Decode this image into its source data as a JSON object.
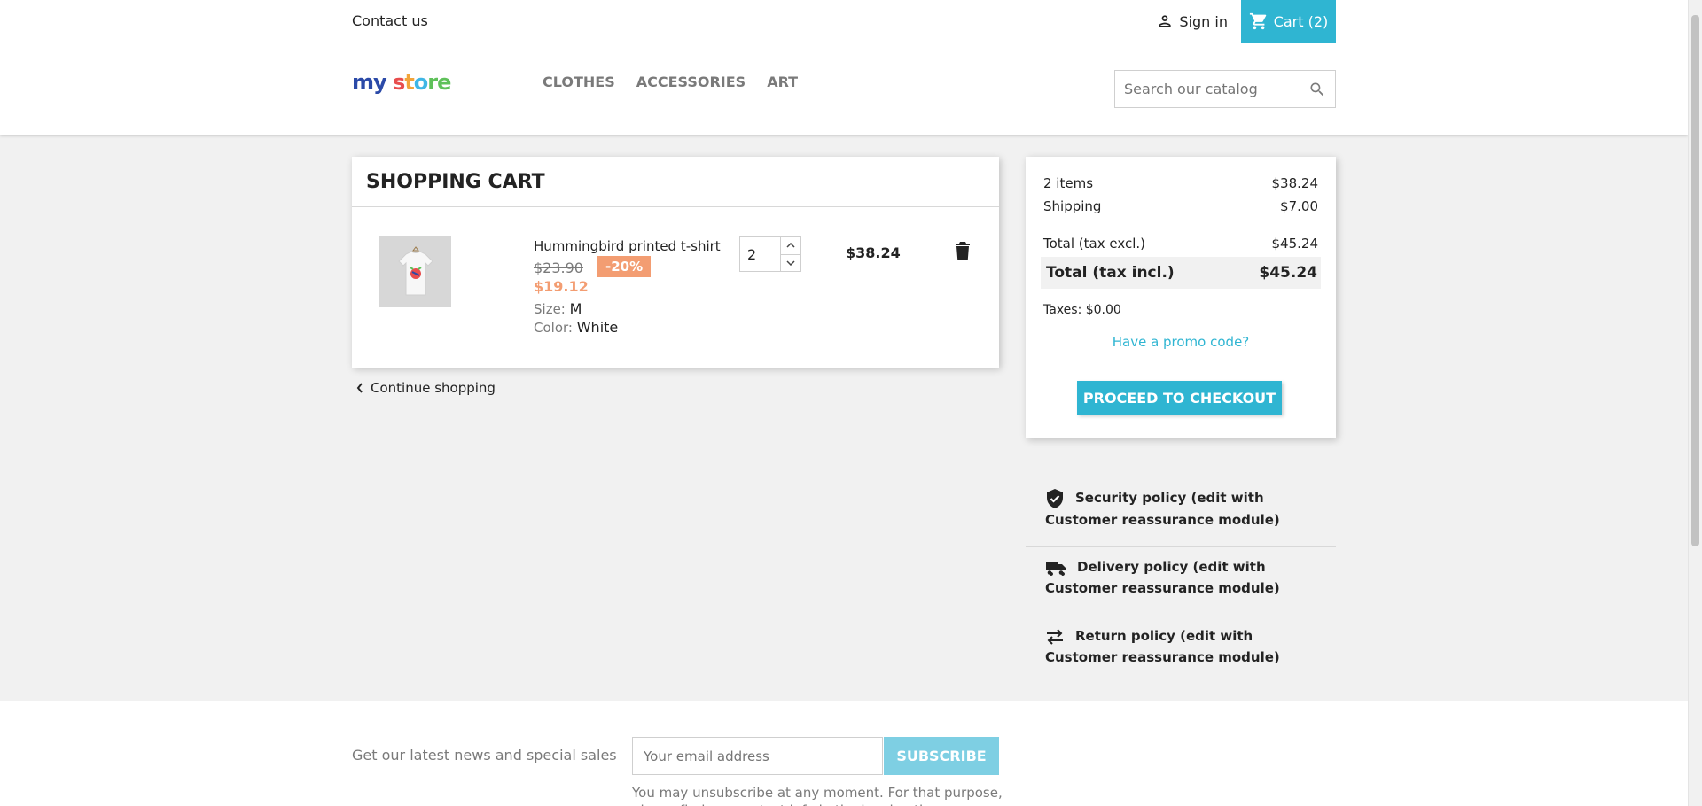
{
  "topbar": {
    "contact": "Contact us",
    "signin": "Sign in",
    "cart": "Cart (2)"
  },
  "header": {
    "logo": {
      "part1": "my",
      "part2": "s",
      "part3": "t",
      "part4": "o",
      "part5": "re"
    },
    "nav": [
      "CLOTHES",
      "ACCESSORIES",
      "ART"
    ],
    "search_placeholder": "Search our catalog"
  },
  "cart": {
    "title": "SHOPPING CART",
    "item": {
      "name": "Hummingbird printed t-shirt",
      "old_price": "$23.90",
      "discount": "-20%",
      "price": "$19.12",
      "size_label": "Size:",
      "size_value": "M",
      "color_label": "Color:",
      "color_value": "White",
      "quantity": "2",
      "line_total": "$38.24"
    },
    "continue": "Continue shopping"
  },
  "summary": {
    "items_label": "2 items",
    "items_value": "$38.24",
    "shipping_label": "Shipping",
    "shipping_value": "$7.00",
    "total_excl_label": "Total (tax excl.)",
    "total_excl_value": "$45.24",
    "total_incl_label": "Total (tax incl.)",
    "total_incl_value": "$45.24",
    "taxes": "Taxes: $0.00",
    "promo": "Have a promo code?",
    "checkout": "PROCEED TO CHECKOUT"
  },
  "reassurance": {
    "security": "Security policy (edit with Customer reassurance module)",
    "delivery": "Delivery policy (edit with Customer reassurance module)",
    "return": "Return policy (edit with Customer reassurance module)"
  },
  "newsletter": {
    "text": "Get our latest news and special sales",
    "placeholder": "Your email address",
    "button": "SUBSCRIBE",
    "note": "You may unsubscribe at any moment. For that purpose, please find our contact info in the legal notice."
  },
  "colors": {
    "accent": "#2fb5d2",
    "discount": "#f39d72"
  }
}
